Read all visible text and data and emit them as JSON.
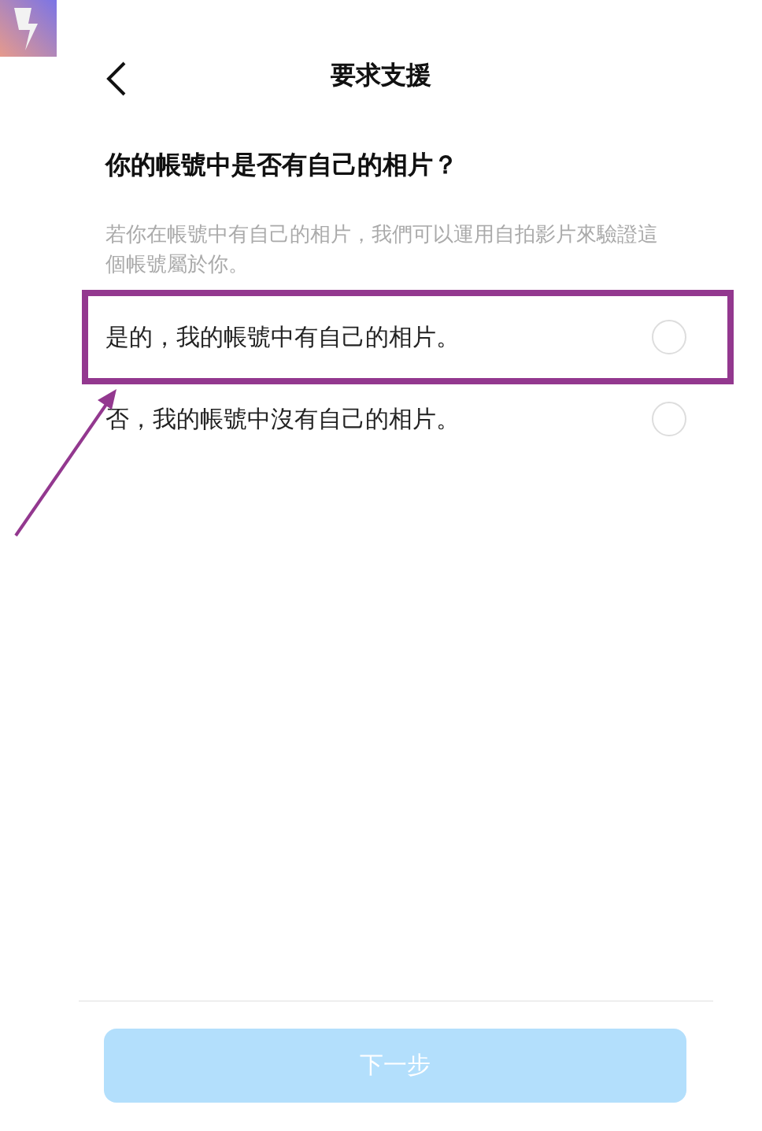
{
  "header": {
    "back_icon": true,
    "title": "要求支援"
  },
  "question": "你的帳號中是否有自己的相片？",
  "description": "若你在帳號中有自己的相片，我們可以運用自拍影片來驗證這個帳號屬於你。",
  "options": [
    {
      "label": "是的，我的帳號中有自己的相片。",
      "selected": false,
      "highlighted": true
    },
    {
      "label": "否，我的帳號中沒有自己的相片。",
      "selected": false,
      "highlighted": false
    }
  ],
  "next_button": {
    "label": "下一步",
    "disabled": true
  }
}
